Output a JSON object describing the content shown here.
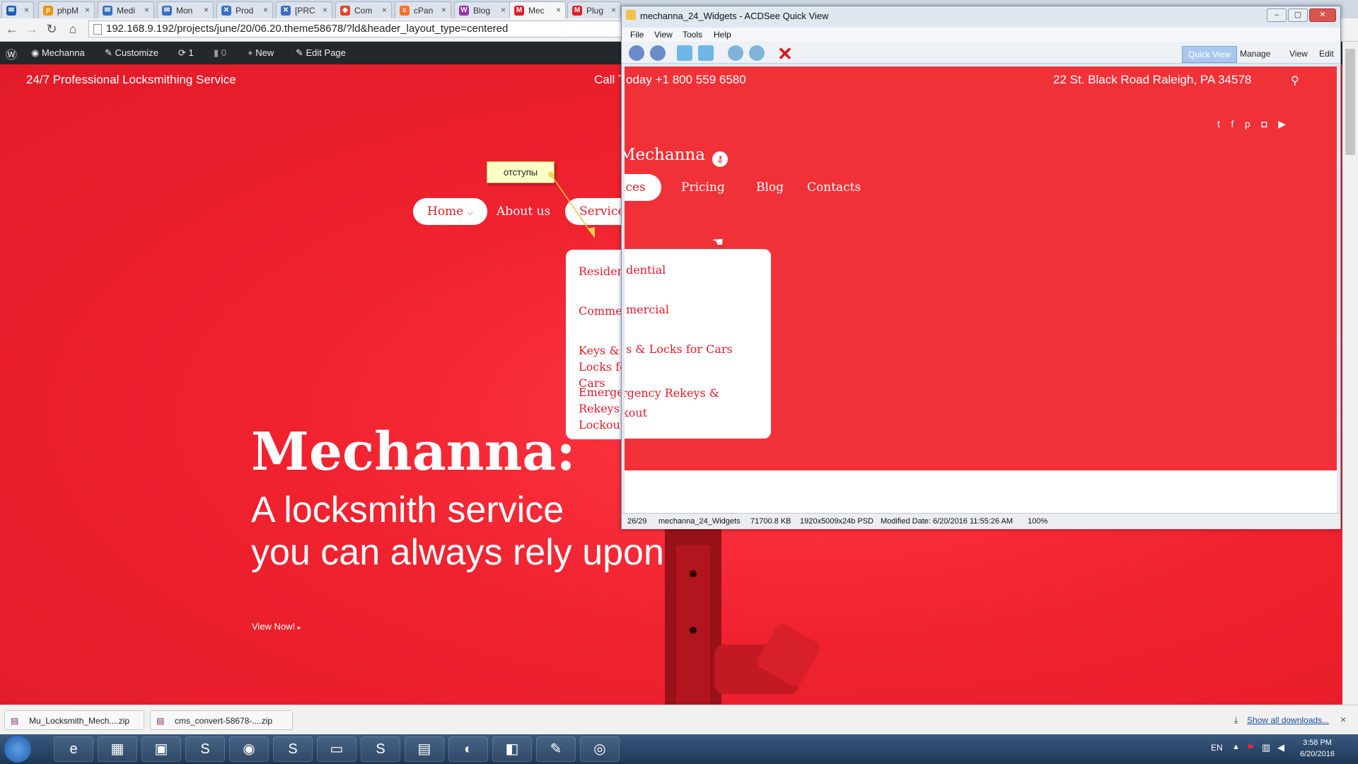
{
  "tabs": [
    {
      "icon": "mail-icon",
      "label": "",
      "color": "#1e5fb4"
    },
    {
      "icon": "php-icon",
      "label": "phpM",
      "color": "#f29111"
    },
    {
      "icon": "mail-icon",
      "label": "Medi",
      "color": "#3a6fc4"
    },
    {
      "icon": "mail-icon",
      "label": "Mon",
      "color": "#3a6fc4"
    },
    {
      "icon": "x-icon",
      "label": "Prod",
      "color": "#3a6fc4"
    },
    {
      "icon": "x-icon",
      "label": "[PRC",
      "color": "#3a6fc4"
    },
    {
      "icon": "gitlab-icon",
      "label": "Com",
      "color": "#e2432a"
    },
    {
      "icon": "cpanel-icon",
      "label": "cPan",
      "color": "#ff6c2c"
    },
    {
      "icon": "wp-icon",
      "label": "Blog",
      "color": "#9b2fae"
    },
    {
      "icon": "m-icon",
      "label": "Mec",
      "color": "#e21b29",
      "active": true
    },
    {
      "icon": "m-icon",
      "label": "Plug",
      "color": "#e21b29"
    }
  ],
  "browser": {
    "url": "192.168.9.192/projects/june/20/06.20.theme58678/?ld&header_layout_type=centered"
  },
  "wpbar": {
    "site": "Mechanna",
    "customize": "Customize",
    "updates": "1",
    "comments": "0",
    "new": "New",
    "edit": "Edit Page"
  },
  "site": {
    "tagline": "24/7 Professional Locksmithing Service",
    "call": "Call Today +1 800 559 6580",
    "address": "22 St. Black Road  Raleigh, PA 34578",
    "logo": "Mechanna",
    "nav": [
      {
        "label": "Home"
      },
      {
        "label": "About us"
      },
      {
        "label": "Services"
      },
      {
        "label": "Pricing"
      },
      {
        "label": "Blog"
      },
      {
        "label": "Contacts"
      }
    ],
    "dropdown": [
      "Residential",
      "Commercial",
      "Keys & Locks for Cars",
      "Emergency Rekeys & Lockout"
    ],
    "hero_title": "Mechanna:",
    "hero_line1": "A locksmith service",
    "hero_line2": "you can always rely upon!",
    "cta": "View Now!"
  },
  "sticky_note": "отступы",
  "acdsee": {
    "title": "mechanna_24_Widgets - ACDSee Quick View",
    "menu": [
      "File",
      "View",
      "Tools",
      "Help"
    ],
    "modes": [
      "Quick View",
      "Manage",
      "View",
      "Edit"
    ],
    "status": [
      "26/29",
      "mechanna_24_Widgets",
      "71700.8 KB",
      "1920x5009x24b PSD",
      "Modified Date: 6/20/2016 11:55:26 AM",
      "100%"
    ]
  },
  "downloads": {
    "items": [
      "Mu_Locksmith_Mech....zip",
      "cms_convert-58678-....zip"
    ],
    "show_all": "Show all downloads..."
  },
  "tray": {
    "lang": "EN",
    "time": "3:58 PM",
    "date": "6/20/2016"
  },
  "colors": {
    "brand": "#e21b29",
    "wpbar": "#23282d"
  }
}
